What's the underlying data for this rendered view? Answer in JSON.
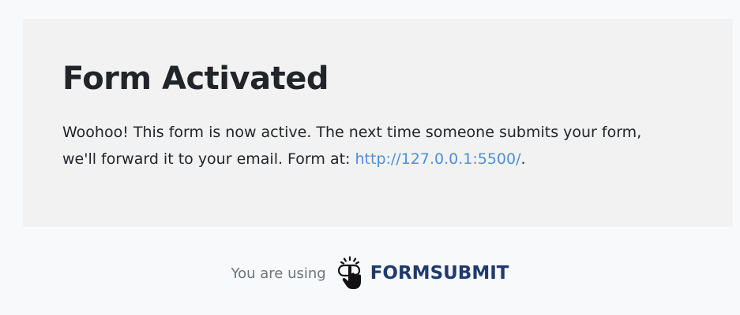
{
  "card": {
    "title": "Form Activated",
    "message_part1": "Woohoo! This form is now active. The next time someone submits your form, we'll forward it to your email. Form at: ",
    "link_text": "http://127.0.0.1:5500/",
    "message_part2": "."
  },
  "footer": {
    "using_text": "You are using",
    "brand_name": "FORMSUBMIT",
    "brand_icon": "pointer-hand-icon"
  },
  "colors": {
    "page_background": "#f8f9fb",
    "card_background": "#f2f2f2",
    "title_text": "#212529",
    "link": "#4a90d9",
    "footer_text": "#6c757d",
    "brand": "#1e3a6e"
  }
}
